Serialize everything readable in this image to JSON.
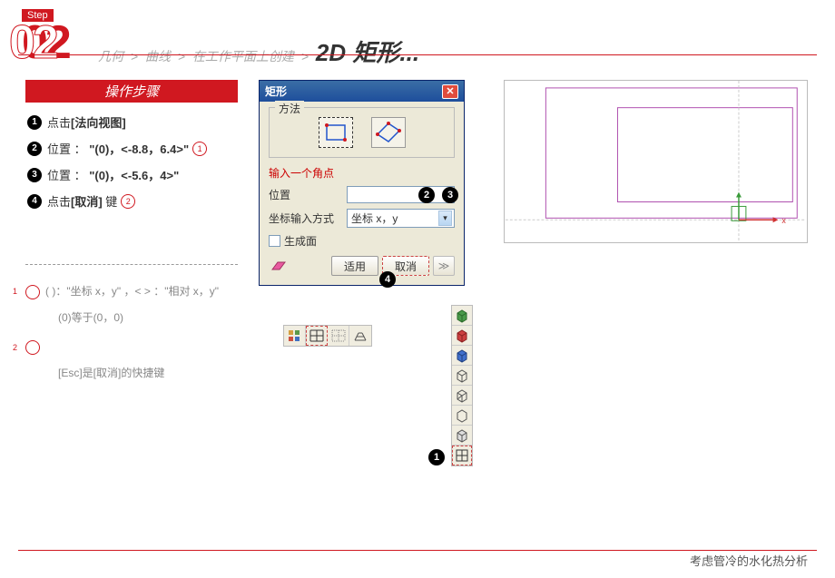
{
  "header": {
    "step_label": "Step",
    "step_num": "02",
    "breadcrumb": [
      "几何",
      "曲线",
      "在工作平面上创建"
    ],
    "sep": ">",
    "current": "2D 矩形..."
  },
  "instructions": {
    "title": "操作步骤",
    "steps": [
      {
        "n": "1",
        "pre": "点击",
        "bold": "[法向视图]",
        "post": "",
        "hint": ""
      },
      {
        "n": "2",
        "pre": "位置 ： ",
        "bold": "\"(0)，<-8.8，6.4>\"",
        "post": "",
        "hint": "1"
      },
      {
        "n": "3",
        "pre": "位置 ： ",
        "bold": "\"(0)，<-5.6，4>\"",
        "post": "",
        "hint": ""
      },
      {
        "n": "4",
        "pre": "点击",
        "bold": "[取消]",
        "post": " 键",
        "hint": "2"
      }
    ]
  },
  "notes": {
    "n1": {
      "badge": "1",
      "line1": "(    )：\"坐标 x，y\" ，<    > ：\"相对 x，y\"",
      "line2": "(0)等于(0，0)"
    },
    "n2": {
      "badge": "2",
      "line1": "[Esc]是[取消]的快捷键"
    }
  },
  "dialog": {
    "title": "矩形",
    "method_legend": "方法",
    "red_hint": "输入一个角点",
    "pos_label": "位置",
    "coord_label": "坐标输入方式",
    "coord_value": "坐标 x，y",
    "gen_surface": "生成面",
    "apply": "适用",
    "cancel": "取消",
    "pos_badge_a": "2",
    "pos_badge_b": "3",
    "cancel_badge": "4"
  },
  "vstrip_badge": "1",
  "footer": "考虑管冷的水化热分析"
}
